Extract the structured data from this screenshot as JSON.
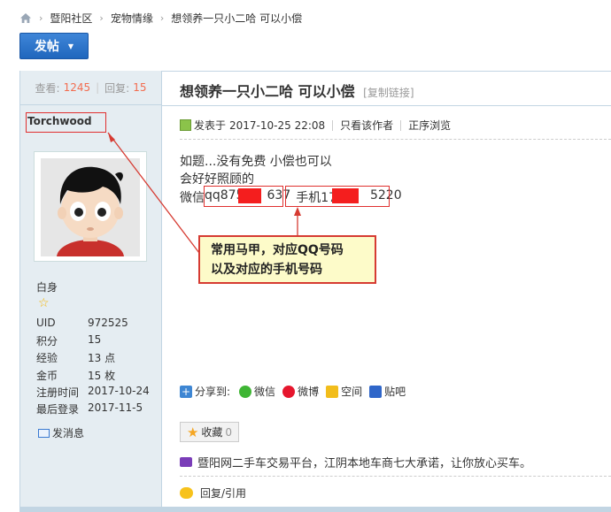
{
  "breadcrumb": {
    "items": [
      "暨阳社区",
      "宠物情缘",
      "想领养一只小二哈 可以小偿"
    ]
  },
  "toolbar": {
    "post_label": "发帖"
  },
  "thread": {
    "views_label": "查看:",
    "views": "1245",
    "replies_label": "回复:",
    "replies": "15",
    "title": "想领养一只小二哈 可以小偿",
    "copy_link": "[复制链接]"
  },
  "author": {
    "username": "Torchwood",
    "group": "白身",
    "info": [
      {
        "key": "UID",
        "value": "972525"
      },
      {
        "key": "积分",
        "value": "15"
      },
      {
        "key": "经验",
        "value": "13 点"
      },
      {
        "key": "金币",
        "value": "15 枚"
      },
      {
        "key": "注册时间",
        "value": "2017-10-24"
      },
      {
        "key": "最后登录",
        "value": "2017-11-5"
      }
    ],
    "send_message": "发消息"
  },
  "post": {
    "posted_prefix": "发表于",
    "posted_time": "2017-10-25 22:08",
    "only_author": "只看该作者",
    "order_view": "正序浏览",
    "line1": "如题...没有免费 小偿也可以",
    "line2": "会好好照顾的",
    "line3_prefix": "微信",
    "qq_start": "qq875",
    "qq_end": "637",
    "phone_prefix": "手机176",
    "phone_end": "5220"
  },
  "annotation": {
    "line1": "常用马甲，对应QQ号码",
    "line2": "以及对应的手机号码"
  },
  "share": {
    "label": "分享到:",
    "targets": [
      "微信",
      "微博",
      "空间",
      "贴吧"
    ]
  },
  "favorite": {
    "label": "收藏",
    "count": "0"
  },
  "ad": {
    "text": "暨阳网二手车交易平台，江阴本地车商七大承诺，让你放心买车。"
  },
  "reply": {
    "label": "回复/引用"
  },
  "colors": {
    "accent": "#2b6fc8",
    "highlight": "#e0302f",
    "sidebar_bg": "#e5edf2"
  }
}
